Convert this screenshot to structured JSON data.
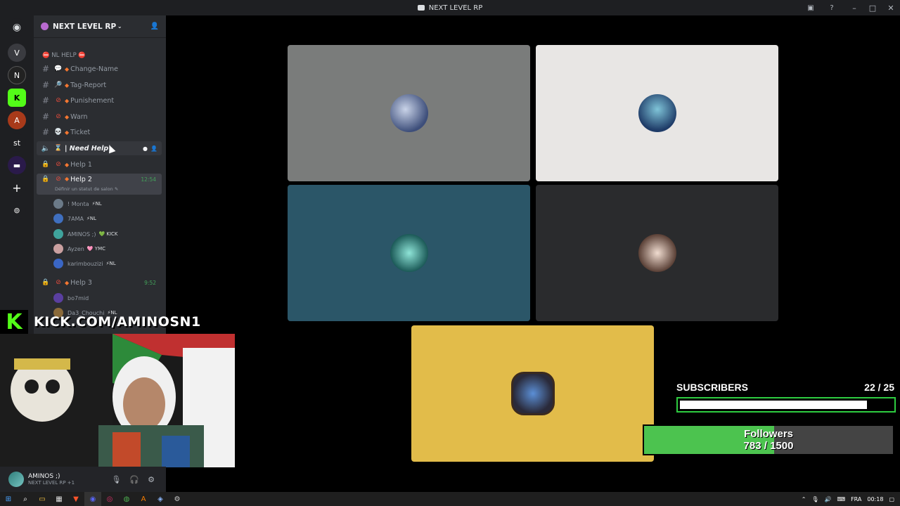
{
  "window": {
    "title": "NEXT LEVEL RP"
  },
  "server": {
    "name": "NEXT LEVEL RP",
    "category": "⛔ NL HELP ⛔"
  },
  "channels": [
    {
      "icon": "speech-bubble",
      "label": "Change-Name"
    },
    {
      "icon": "magnifier",
      "label": "Tag-Report"
    },
    {
      "icon": "no-entry",
      "label": "Punishement"
    },
    {
      "icon": "no-entry",
      "label": "Warn"
    },
    {
      "icon": "skull",
      "label": "Ticket"
    },
    {
      "icon": "hourglass",
      "label": "| Need Help|"
    },
    {
      "icon": "no-entry",
      "label": "Help 1"
    },
    {
      "icon": "no-entry",
      "label": "Help 2",
      "time": "12:54",
      "status": "Définir un statut de salon"
    },
    {
      "icon": "no-entry",
      "label": "Help 3",
      "time": "9:52"
    }
  ],
  "voice_users_help2": [
    {
      "name": "! Monta",
      "tag": "⚡NL",
      "avatar_color": "#6b7a88"
    },
    {
      "name": "7AMA",
      "tag": "⚡NL",
      "avatar_color": "#3f6fbf"
    },
    {
      "name": "AMINOS ;)",
      "tag": "💚 KICK",
      "avatar_color": "#3fa39c"
    },
    {
      "name": "Ayzen",
      "tag": "🩷 YMC",
      "avatar_color": "#caa0a0"
    },
    {
      "name": "karimbouzizi",
      "tag": "⚡NL",
      "avatar_color": "#3a66c4"
    }
  ],
  "voice_users_help3": [
    {
      "name": "bo7mid",
      "tag": "",
      "avatar_color": "#5a3fa0"
    },
    {
      "name": "Da3_Chouchi",
      "tag": "⚡NL",
      "avatar_color": "#8a6a3a"
    }
  ],
  "user_panel": {
    "name": "AMINOS ;)",
    "status": "NEXT LEVEL RP +1"
  },
  "video_tiles": [
    {
      "name": "tile-1",
      "bg": "#7a7c7b"
    },
    {
      "name": "tile-2",
      "bg": "#e8e6e4"
    },
    {
      "name": "tile-3",
      "bg": "#2b5668"
    },
    {
      "name": "tile-4",
      "bg": "#2a2b2d"
    },
    {
      "name": "tile-5",
      "bg": "#e2bc4a"
    }
  ],
  "overlay": {
    "kick_url": "KICK.COM/AMINOSN1",
    "kick_logo": "K",
    "subscribers_label": "SUBSCRIBERS",
    "subscribers_count": "22  / 25",
    "subscribers_fraction": 0.88,
    "followers_label": "Followers",
    "followers_count": "783  / 1500",
    "followers_fraction": 0.522
  },
  "taskbar": {
    "lang": "FRA",
    "time": "00:18"
  },
  "colors": {
    "discord_bg": "#2b2d31",
    "rail_bg": "#1e1f22",
    "accent_green": "#23a55a",
    "kick_green": "#53fc18"
  }
}
